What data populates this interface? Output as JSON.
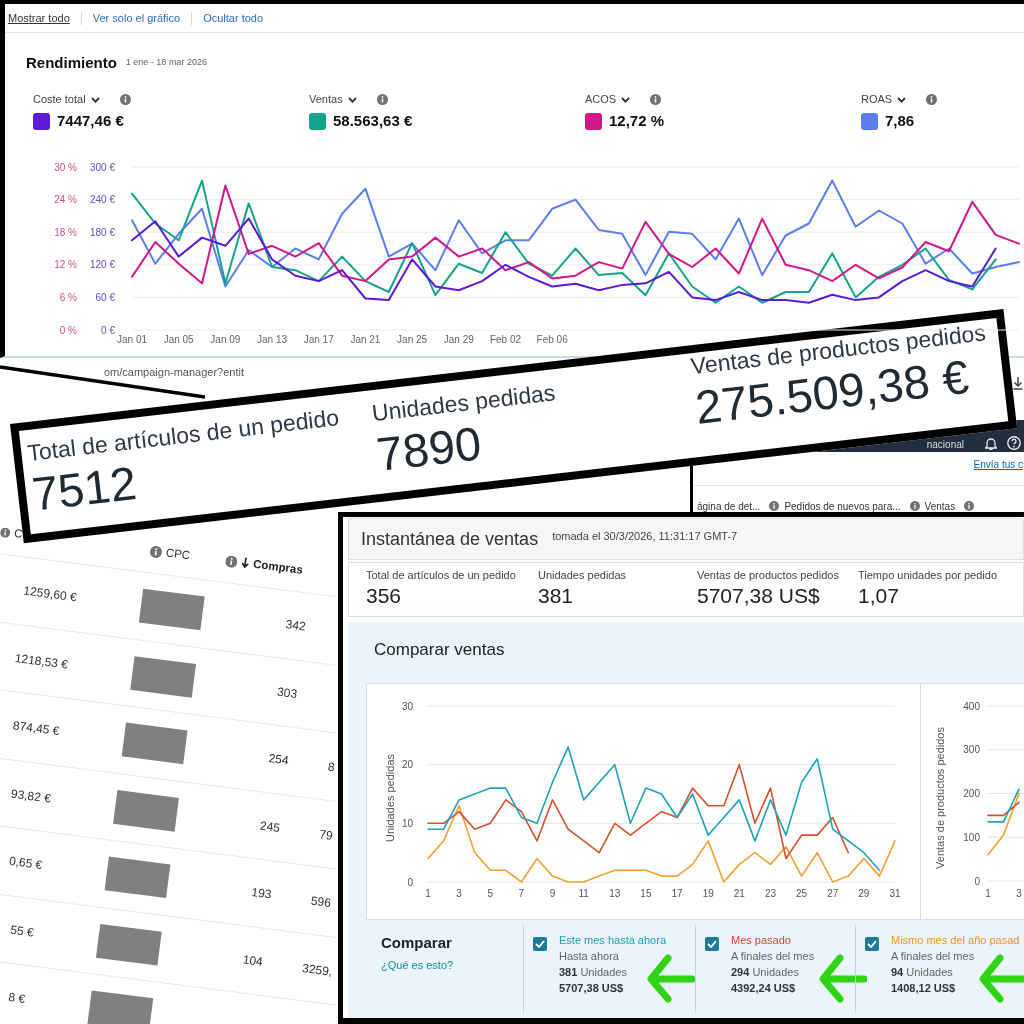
{
  "performance_panel": {
    "view_links": [
      {
        "label": "Mostrar todo",
        "selected": true
      },
      {
        "label": "Ver solo el gráfico",
        "selected": false
      },
      {
        "label": "Ocultar todo",
        "selected": false
      }
    ],
    "title": "Rendimiento",
    "date_range": "1 ene - 18 mar 2026",
    "metrics": [
      {
        "label": "Coste total",
        "value": "7447,46 €",
        "color": "#5b1bd8"
      },
      {
        "label": "Ventas",
        "value": "58.563,63 €",
        "color": "#14a38b"
      },
      {
        "label": "ACOS",
        "value": "12,72 %",
        "color": "#d4168c"
      },
      {
        "label": "ROAS",
        "value": "7,86",
        "color": "#5b7ff2"
      }
    ],
    "chart": {
      "secondary_axis": [
        "30 %",
        "24 %",
        "18 %",
        "12 %",
        "6 %",
        "0 %"
      ],
      "chart_data": {
        "type": "line",
        "grid": true,
        "categories": [
          "Jan 01",
          null,
          "Jan 05",
          null,
          "Jan 09",
          null,
          "Jan 13",
          null,
          "Jan 17",
          null,
          "Jan 21",
          null,
          "Jan 25",
          null,
          "Jan 29",
          null,
          "Feb 02",
          null,
          "Feb 06",
          null,
          null,
          null,
          null,
          null,
          null,
          null,
          null,
          null,
          null,
          null,
          null,
          null,
          null,
          null,
          null,
          null,
          null,
          null,
          null
        ],
        "ylim": [
          0,
          300
        ],
        "yticks": [
          {
            "value": 0,
            "label": "0 €"
          },
          {
            "value": 60,
            "label": "60 €"
          },
          {
            "value": 120,
            "label": "120 €"
          },
          {
            "value": 180,
            "label": "180 €"
          },
          {
            "value": 240,
            "label": "240 €"
          },
          {
            "value": 300,
            "label": "300 €"
          }
        ],
        "series": [
          {
            "color": "#5b7ff2",
            "values": [
              202,
              122,
              177,
              223,
              80,
              147,
              116,
              150,
              130,
              214,
              260,
              135,
              159,
              110,
              202,
              141,
              165,
              165,
              223,
              240,
              184,
              177,
              101,
              181,
              177,
              130,
              205,
              101,
              174,
              196,
              275,
              190,
              220,
              196,
              122,
              150,
              104,
              116,
              125
            ]
          },
          {
            "color": "#14a38b",
            "values": [
              251,
              196,
              165,
              275,
              86,
              233,
              116,
              110,
              90,
              135,
              90,
              70,
              160,
              64,
              122,
              105,
              180,
              122,
              100,
              150,
              101,
              105,
              64,
              141,
              80,
              50,
              80,
              50,
              70,
              70,
              141,
              60,
              98,
              120,
              150,
              92,
              75,
              130,
              null
            ]
          },
          {
            "color": "#d4168c",
            "values": [
              98,
              162,
              122,
              86,
              266,
              140,
              155,
              135,
              160,
              100,
              90,
              130,
              135,
              170,
              135,
              150,
              110,
              125,
              95,
              100,
              125,
              113,
              199,
              140,
              116,
              150,
              104,
              205,
              120,
              110,
              90,
              120,
              95,
              115,
              162,
              145,
              236,
              175,
              159
            ]
          },
          {
            "color": "#5b1bd8",
            "values": [
              165,
              200,
              135,
              170,
              155,
              205,
              130,
              100,
              90,
              110,
              58,
              55,
              130,
              80,
              73,
              90,
              120,
              98,
              80,
              85,
              73,
              83,
              86,
              107,
              60,
              55,
              70,
              55,
              55,
              50,
              65,
              55,
              60,
              90,
              110,
              90,
              80,
              150,
              null
            ]
          }
        ]
      }
    }
  },
  "campaign_table": {
    "url": "om/campaign-manager?entit",
    "columns": [
      {
        "label": "C",
        "sorted": false
      },
      {
        "label": "CPC",
        "sorted": false
      },
      {
        "label": "Compras",
        "sorted": true
      }
    ],
    "rows": [
      {
        "column_1": "1259,60 €",
        "cpc_redacted": true,
        "purchases": "342"
      },
      {
        "column_1": "1218,53 €",
        "cpc_redacted": true,
        "purchases": "303"
      },
      {
        "column_1": "874,45 €",
        "cpc_redacted": true,
        "purchases": "254",
        "column_4": "8"
      },
      {
        "column_1": "93,82 €",
        "cpc_redacted": true,
        "purchases": "245",
        "column_4": "79"
      },
      {
        "column_1": "0,65 €",
        "cpc_redacted": true,
        "purchases": "193",
        "column_4": "596"
      },
      {
        "column_1": "55 €",
        "cpc_redacted": true,
        "purchases": "104",
        "column_4": "3259,"
      },
      {
        "column_1": "8 €",
        "cpc_redacted": true
      }
    ]
  },
  "second_fragment": {
    "nav_text": "nacional",
    "link": "Envía tus c",
    "columns": [
      {
        "label": "ágina de det..."
      },
      {
        "label": "Pedidos de nuevos para..."
      },
      {
        "label": "Ventas"
      }
    ]
  },
  "highlight_banner": {
    "metrics": [
      {
        "label": "Total de artículos de un pedido",
        "value": "7512"
      },
      {
        "label": "Unidades pedidas",
        "value": "7890"
      },
      {
        "label": "Ventas de productos pedidos",
        "value": "275.509,38 €"
      }
    ]
  },
  "sales_snapshot": {
    "title": "Instantánea de ventas",
    "timestamp": "tomada el 30/3/2026, 11:31:17 GMT-7",
    "metrics": [
      {
        "label": "Total de artículos de un pedido",
        "value": "356"
      },
      {
        "label": "Unidades pedidas",
        "value": "381"
      },
      {
        "label": "Ventas de productos pedidos",
        "value": "5707,38 US$"
      },
      {
        "label": "Tiempo unidades por pedido",
        "value": "1,07"
      }
    ],
    "compare": {
      "title": "Comparar ventas",
      "charts": [
        {
          "chart_data": {
            "type": "line",
            "grid": true,
            "ylabel": "Unidades pedidas",
            "x": [
              1,
              2,
              3,
              4,
              5,
              6,
              7,
              8,
              9,
              10,
              11,
              12,
              13,
              14,
              15,
              16,
              17,
              18,
              19,
              20,
              21,
              22,
              23,
              24,
              25,
              26,
              27,
              28,
              29,
              30,
              31
            ],
            "xlim": [
              1,
              31
            ],
            "ylim": [
              0,
              30
            ],
            "xticks": [
              1,
              3,
              5,
              7,
              9,
              11,
              13,
              15,
              17,
              19,
              21,
              23,
              25,
              27,
              29,
              31
            ],
            "yticks": [
              0,
              10,
              20,
              30
            ],
            "series": [
              {
                "color": "#f6a033",
                "values": [
                  4,
                  7,
                  13,
                  5,
                  2,
                  2,
                  0,
                  4,
                  1,
                  0,
                  0,
                  1,
                  2,
                  2,
                  2,
                  1,
                  1,
                  3,
                  7,
                  0,
                  3,
                  5,
                  3,
                  6,
                  1,
                  5,
                  0,
                  1,
                  4,
                  1,
                  7
                ]
              },
              {
                "color": "#d9502f",
                "values": [
                  10,
                  10,
                  12,
                  9,
                  10,
                  14,
                  12,
                  7,
                  14,
                  9,
                  7,
                  5,
                  10,
                  8,
                  10,
                  12,
                  11,
                  16,
                  13,
                  13,
                  20,
                  10,
                  16,
                  4,
                  8,
                  8,
                  11,
                  5,
                  null,
                  null,
                  null
                ]
              },
              {
                "color": "#1ea4b8",
                "values": [
                  9,
                  9,
                  14,
                  15,
                  16,
                  16,
                  11,
                  10,
                  17,
                  23,
                  14,
                  17,
                  20,
                  10,
                  16,
                  15,
                  11,
                  15,
                  8,
                  11,
                  14,
                  7,
                  14,
                  8,
                  17,
                  21,
                  9,
                  7,
                  5,
                  2,
                  null
                ]
              }
            ]
          }
        },
        {
          "chart_data": {
            "type": "line",
            "grid": true,
            "ylabel": "Ventas de productos pedidos",
            "x": [
              1,
              2,
              3
            ],
            "xlim": [
              1,
              3.4
            ],
            "ylim": [
              0,
              400
            ],
            "xticks": [
              1,
              3
            ],
            "yticks": [
              0,
              100,
              200,
              300,
              400
            ],
            "series": [
              {
                "color": "#f6a033",
                "values": [
                  60,
                  105,
                  200
                ]
              },
              {
                "color": "#d9502f",
                "values": [
                  150,
                  150,
                  180
                ]
              },
              {
                "color": "#1ea4b8",
                "values": [
                  135,
                  135,
                  210
                ]
              }
            ]
          }
        }
      ],
      "legend_title": "Comparar",
      "help_link": "¿Qué es esto?",
      "items": [
        {
          "title": "Este mes hasta ahora",
          "subtitle": "Hasta ahora",
          "units": "**381** Unidades",
          "amount": "5707,38 US$",
          "color": "#1a9fb5",
          "checked": true,
          "arrow_annotation": true
        },
        {
          "title": "Mes pasado",
          "subtitle": "A finales del mes",
          "units": "**294** Unidades",
          "amount": "4392,24 US$",
          "color": "#d9462b",
          "checked": true,
          "arrow_annotation": true
        },
        {
          "title": "Mismo mes del año pasad",
          "subtitle": "A finales del mes",
          "units": "**94** Unidades",
          "amount": "1408,12 US$",
          "color": "#f3921d",
          "checked": true,
          "arrow_annotation": true
        }
      ]
    }
  }
}
